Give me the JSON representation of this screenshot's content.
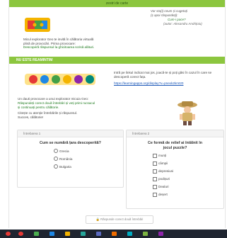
{
  "header": {
    "title": "zestri de carte"
  },
  "poem": {
    "line1": "Vor sta(i) ceum și cugetați",
    "line2": "(ș apoi răspundeți):",
    "question": "Cum-i pace?",
    "author": "(autor: Alexandru Andrițoiu)"
  },
  "intro": {
    "line1": "Micul explorator Geo te invită în călătoria virtuală",
    "line2": "plină de provocări. Prima provocare:",
    "highlight": "Descoperă răspunsul la ghicitoarea scrisă alături."
  },
  "section": {
    "title": "NU ESTE REAMINTIM"
  },
  "remember": {
    "line1": "Intră pe linkul indicat mai jos, joacă-te și poți găsi în cazul în care se",
    "line2": "descoperă corect fața.",
    "link": "https://learningapps.org/display?v=pnexk2kmt20"
  },
  "challenge": {
    "line1": "Un dauti provocare a unui explorator micuia Geo:",
    "line2": "Răspundeți corect două întrebări și veți primi rucsacul",
    "line3": "și continuați pentru călătorie.",
    "line4": "Citește cu atenție întrebările și răspunsul.",
    "line5": "Succes, călătorie!"
  },
  "quiz1": {
    "header": "Întrebarea 1",
    "question": "Cum se numără țara descoperită?",
    "options": [
      "Grecia",
      "România",
      "Bulgaria"
    ]
  },
  "quiz2": {
    "header": "Întrebarea 2",
    "question_line1": "Ce formă de relief ai întâlnit în",
    "question_line2": "jocul puzzle?",
    "options": [
      "munți",
      "câmpii",
      "depresiuni",
      "podișuri",
      "Dealuri",
      "deșert"
    ]
  },
  "submit": {
    "label": "Răspunde corect două întrebări"
  },
  "colors": {
    "accent": "#8cc63f",
    "taskbar": "#1f2530",
    "link": "#1a57b8"
  }
}
